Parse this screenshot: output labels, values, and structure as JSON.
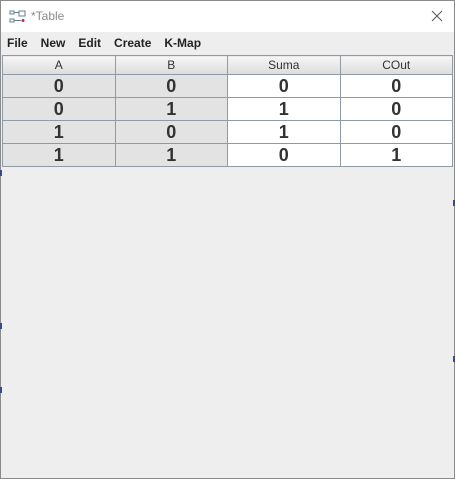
{
  "window": {
    "title": "*Table",
    "icon": "logic-circuit-icon",
    "close_icon": "close-icon"
  },
  "menubar": {
    "items": [
      {
        "label": "File"
      },
      {
        "label": "New"
      },
      {
        "label": "Edit"
      },
      {
        "label": "Create"
      },
      {
        "label": "K-Map"
      }
    ]
  },
  "table": {
    "headers": [
      "A",
      "B",
      "Suma",
      "COut"
    ],
    "rows": [
      [
        "0",
        "0",
        "0",
        "0"
      ],
      [
        "0",
        "1",
        "1",
        "0"
      ],
      [
        "1",
        "0",
        "1",
        "0"
      ],
      [
        "1",
        "1",
        "0",
        "1"
      ]
    ]
  },
  "colors": {
    "input_cell_bg": "#e3e3e3",
    "output_cell_bg": "#ffffff",
    "grid_line": "#8f9aa5"
  }
}
